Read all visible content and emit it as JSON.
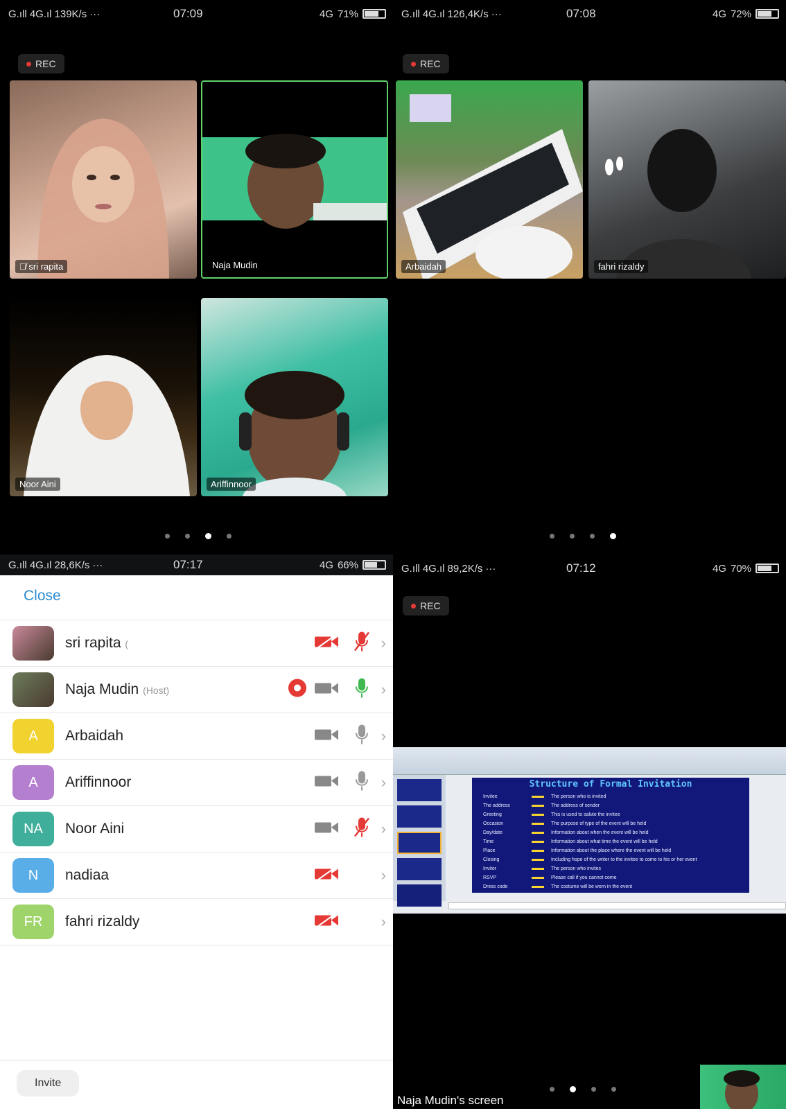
{
  "panels": {
    "tl": {
      "status": {
        "carrier": "G.ıll 4G.ıl",
        "speed": "139K/s",
        "more": "···",
        "time": "07:09",
        "net": "4G",
        "battery": "71%",
        "battery_level": 0.71
      },
      "rec": "REC",
      "tiles": [
        {
          "name": "sri rapita"
        },
        {
          "name": "Naja Mudin"
        },
        {
          "name": "Noor Aini"
        },
        {
          "name": "Ariffinnoor"
        }
      ],
      "page_count": 4,
      "active_page": 3
    },
    "tr": {
      "status": {
        "carrier": "G.ıll 4G.ıl",
        "speed": "126,4K/s",
        "more": "···",
        "time": "07:08",
        "net": "4G",
        "battery": "72%",
        "battery_level": 0.72
      },
      "rec": "REC",
      "tiles": [
        {
          "name": "Arbaidah"
        },
        {
          "name": "fahri rizaldy"
        }
      ],
      "page_count": 4,
      "active_page": 4
    },
    "bl": {
      "status": {
        "carrier": "G.ıll 4G.ıl",
        "speed": "28,6K/s",
        "more": "···",
        "time": "07:17",
        "net": "4G",
        "battery": "66%",
        "battery_level": 0.66
      },
      "close_label": "Close",
      "participants": [
        {
          "name": "sri rapita",
          "suffix": "(",
          "initials": "",
          "color": "#c98a9a",
          "video": "off",
          "mic": "muted"
        },
        {
          "name": "Naja Mudin",
          "suffix": "(Host)",
          "initials": "",
          "color": "#6b7c5a",
          "video": "on",
          "mic": "active",
          "recording": true
        },
        {
          "name": "Arbaidah",
          "suffix": "",
          "initials": "A",
          "color": "#f2d22e",
          "video": "on",
          "mic": "on"
        },
        {
          "name": "Ariffinnoor",
          "suffix": "",
          "initials": "A",
          "color": "#b57fd0",
          "video": "on",
          "mic": "on"
        },
        {
          "name": "Noor Aini",
          "suffix": "",
          "initials": "NA",
          "color": "#3fae9a",
          "video": "on",
          "mic": "muted"
        },
        {
          "name": "nadiaa",
          "suffix": "",
          "initials": "N",
          "color": "#5aaee8",
          "video": "off",
          "mic": "none"
        },
        {
          "name": "fahri rizaldy",
          "suffix": "",
          "initials": "FR",
          "color": "#9ed46a",
          "video": "off",
          "mic": "none"
        }
      ],
      "invite_label": "Invite"
    },
    "br": {
      "status": {
        "carrier": "G.ıll 4G.ıl",
        "speed": "89,2K/s",
        "more": "···",
        "time": "07:12",
        "net": "4G",
        "battery": "70%",
        "battery_level": 0.7
      },
      "rec": "REC",
      "slide": {
        "title": "Structure of Formal Invitation",
        "rows": [
          [
            "Invitee",
            "The person who is invited"
          ],
          [
            "The address",
            "The address of sender"
          ],
          [
            "Greeting",
            "This is used to salute the invitee"
          ],
          [
            "Occasion",
            "The purpose of type of the event will be held"
          ],
          [
            "Day/date",
            "Information about when the event will be held"
          ],
          [
            "Time",
            "Information about what time the event will be held"
          ],
          [
            "Place",
            "Information about the place where the event will be held"
          ],
          [
            "Closing",
            "Including hope of the writer to the invitee to come to his or her event"
          ],
          [
            "Invitor",
            "The person who invites"
          ],
          [
            "RSVP",
            "Please call if you cannot come"
          ],
          [
            "Dress code",
            "The costume will be worn in the event"
          ]
        ]
      },
      "screen_label": "Naja Mudin's screen",
      "page_count": 4,
      "active_page": 2
    }
  }
}
